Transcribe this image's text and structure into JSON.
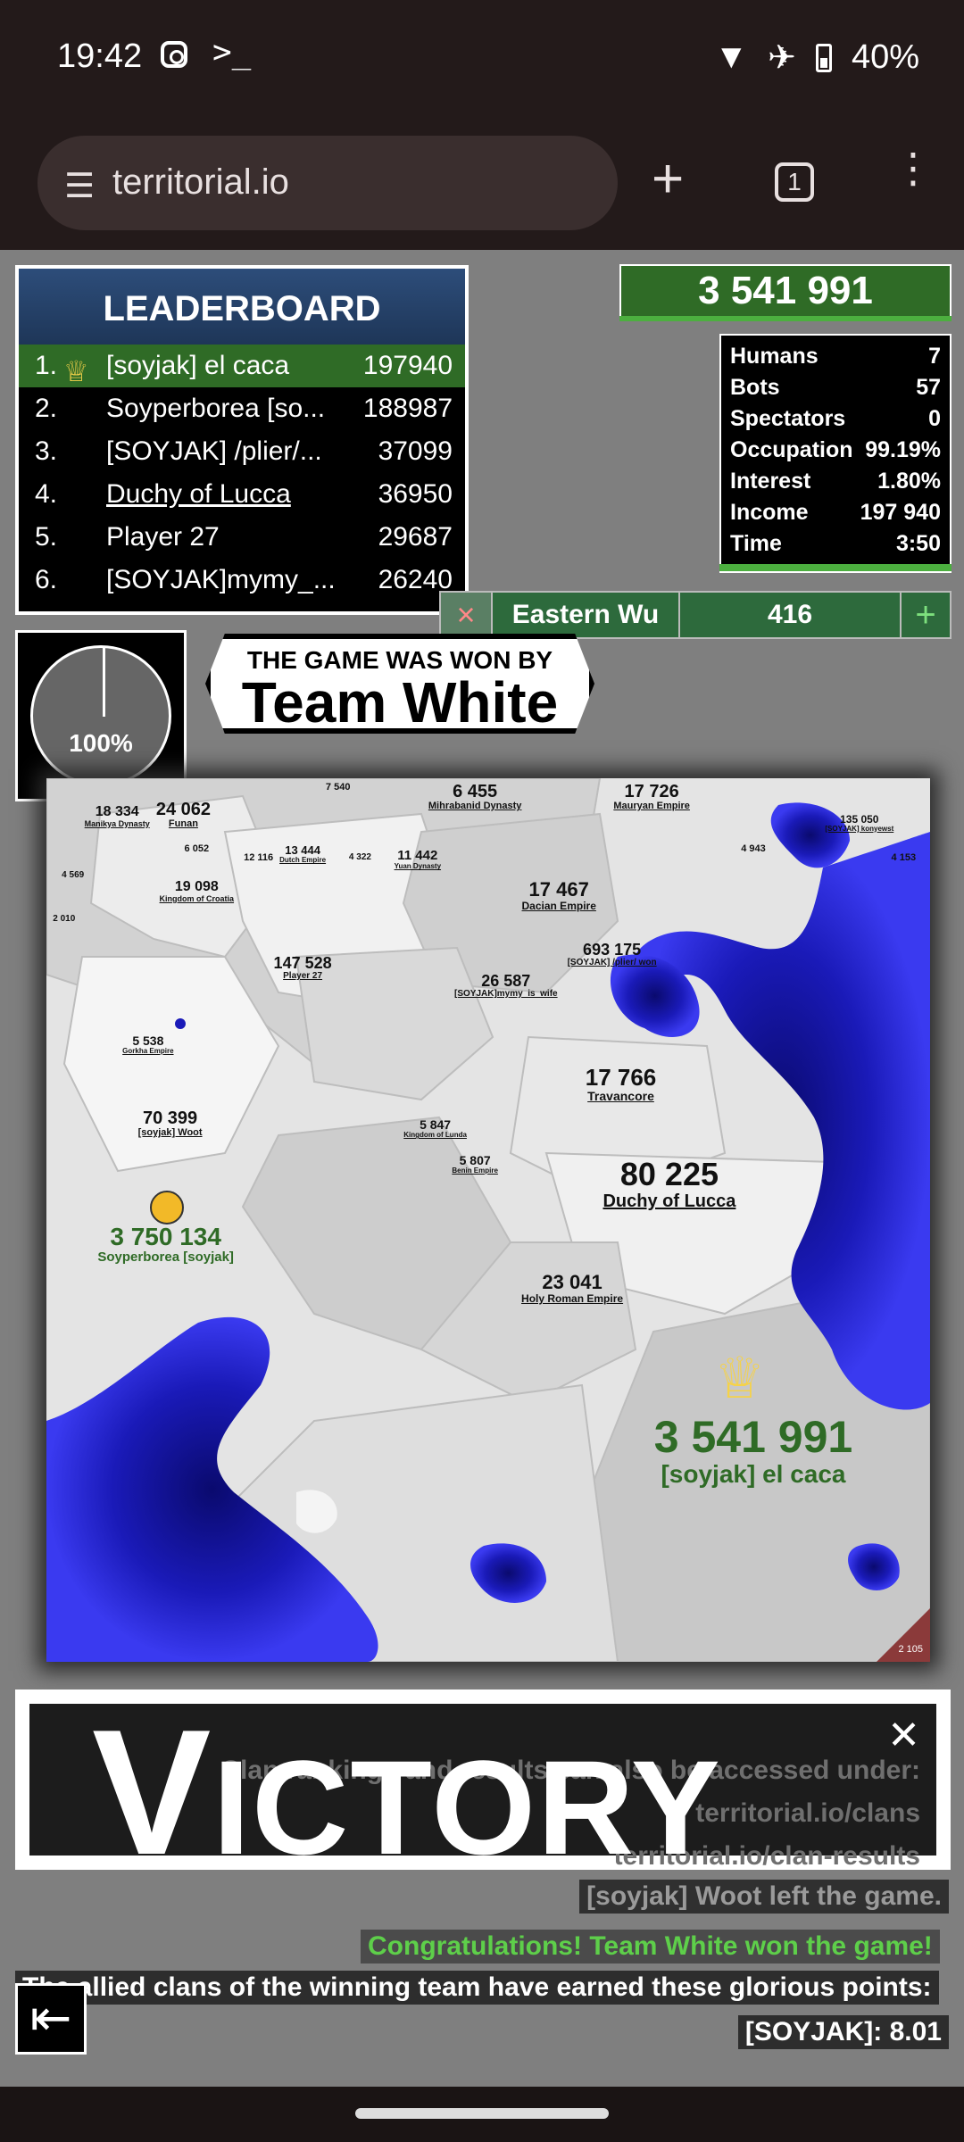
{
  "status": {
    "time": "19:42",
    "battery": "40%"
  },
  "browser": {
    "url": "territorial.io",
    "tabs": "1"
  },
  "leaderboard": {
    "title": "LEADERBOARD",
    "rows": [
      {
        "rank": "1.",
        "name": "[soyjak] el caca",
        "score": "197940"
      },
      {
        "rank": "2.",
        "name": "Soyperborea [so...",
        "score": "188987"
      },
      {
        "rank": "3.",
        "name": "[SOYJAK] /plier/...",
        "score": "37099"
      },
      {
        "rank": "4.",
        "name": "Duchy of Lucca",
        "score": "36950"
      },
      {
        "rank": "5.",
        "name": "Player 27",
        "score": "29687"
      },
      {
        "rank": "6.",
        "name": "[SOYJAK]mymy_...",
        "score": "26240"
      }
    ]
  },
  "score": "3 541 991",
  "stats": [
    {
      "label": "Humans",
      "value": "7"
    },
    {
      "label": "Bots",
      "value": "57"
    },
    {
      "label": "Spectators",
      "value": "0"
    },
    {
      "label": "Occupation",
      "value": "99.19%"
    },
    {
      "label": "Interest",
      "value": "1.80%"
    },
    {
      "label": "Income",
      "value": "197 940"
    },
    {
      "label": "Time",
      "value": "3:50"
    }
  ],
  "target": {
    "close": "×",
    "name": "Eastern Wu",
    "value": "416",
    "plus": "+"
  },
  "pie": {
    "percent": "100%",
    "fraction": 1.0
  },
  "won": {
    "line1": "THE GAME WAS WON BY",
    "line2": "Team White"
  },
  "map": {
    "labels": [
      {
        "n": "18 334",
        "s": "Manikya Dynasty",
        "x": 8,
        "y": 3,
        "f": 16
      },
      {
        "n": "24 062",
        "s": "Funan",
        "x": 15.5,
        "y": 2.5,
        "f": 20
      },
      {
        "n": "7 540",
        "s": "",
        "x": 33,
        "y": 0.5,
        "f": 11
      },
      {
        "n": "6 455",
        "s": "Mihrabanid Dynasty",
        "x": 48.5,
        "y": 0.5,
        "f": 20
      },
      {
        "n": "17 726",
        "s": "Mauryan Empire",
        "x": 68.5,
        "y": 0.5,
        "f": 20
      },
      {
        "n": "135 050",
        "s": "[SOYJAK] konyewst",
        "x": 92,
        "y": 4,
        "f": 12
      },
      {
        "n": "4 153",
        "s": "",
        "x": 97,
        "y": 8.5,
        "f": 11
      },
      {
        "n": "6 052",
        "s": "",
        "x": 17,
        "y": 7.5,
        "f": 11
      },
      {
        "n": "12 116",
        "s": "",
        "x": 24,
        "y": 8.5,
        "f": 11
      },
      {
        "n": "13 444",
        "s": "Dutch Empire",
        "x": 29,
        "y": 7.5,
        "f": 13
      },
      {
        "n": "4 322",
        "s": "",
        "x": 35.5,
        "y": 8.5,
        "f": 10
      },
      {
        "n": "11 442",
        "s": "Yuan Dynasty",
        "x": 42,
        "y": 8,
        "f": 15
      },
      {
        "n": "4 943",
        "s": "",
        "x": 80,
        "y": 7.5,
        "f": 11
      },
      {
        "n": "4 569",
        "s": "",
        "x": 3,
        "y": 10.5,
        "f": 10
      },
      {
        "n": "19 098",
        "s": "Kingdom of Croatia",
        "x": 17,
        "y": 11.5,
        "f": 16
      },
      {
        "n": "17 467",
        "s": "Dacian Empire",
        "x": 58,
        "y": 11.5,
        "f": 22
      },
      {
        "n": "2 010",
        "s": "",
        "x": 2,
        "y": 15.5,
        "f": 10
      },
      {
        "n": "693 175",
        "s": "[SOYJAK] /plier/ won",
        "x": 64,
        "y": 18.5,
        "f": 18
      },
      {
        "n": "147 528",
        "s": "Player 27",
        "x": 29,
        "y": 20,
        "f": 18
      },
      {
        "n": "26 587",
        "s": "[SOYJAK]mymy_is_wife",
        "x": 52,
        "y": 22,
        "f": 18
      },
      {
        "n": "5 538",
        "s": "Gorkha Empire",
        "x": 11.5,
        "y": 29,
        "f": 14
      },
      {
        "n": "17 766",
        "s": "Travancore",
        "x": 65,
        "y": 32.5,
        "f": 26
      },
      {
        "n": "70 399",
        "s": "[soyjak] Woot",
        "x": 14,
        "y": 37.5,
        "f": 20
      },
      {
        "n": "5 847",
        "s": "Kingdom of Lunda",
        "x": 44,
        "y": 38.5,
        "f": 14
      },
      {
        "n": "5 807",
        "s": "Benin Empire",
        "x": 48.5,
        "y": 42.5,
        "f": 14
      },
      {
        "n": "80 225",
        "s": "Duchy of Lucca",
        "x": 70.5,
        "y": 43,
        "f": 36
      },
      {
        "n": "23 041",
        "s": "Holy Roman Empire",
        "x": 59.5,
        "y": 56,
        "f": 22
      }
    ],
    "big": [
      {
        "n": "3 750 134",
        "s": "Soyperborea [soyjak]",
        "x": 13.5,
        "y": 50.5,
        "f": 28
      },
      {
        "n": "3 541 991",
        "s": "[soyjak] el caca",
        "x": 80,
        "y": 72,
        "f": 50
      }
    ],
    "corner": "2 105"
  },
  "victory": {
    "word_first": "V",
    "word_rest": "ICTORY",
    "messages": [
      "Clan rankings and results can also be accessed under:",
      "territorial.io/clans",
      "territorial.io/clan-results",
      "[soyjak] Woot left the game."
    ]
  },
  "bottom": {
    "congrats": "Congratulations! Team White won the game!",
    "allied": "The allied clans of the winning team have earned these glorious points:",
    "points": "[SOYJAK]: 8.01"
  }
}
